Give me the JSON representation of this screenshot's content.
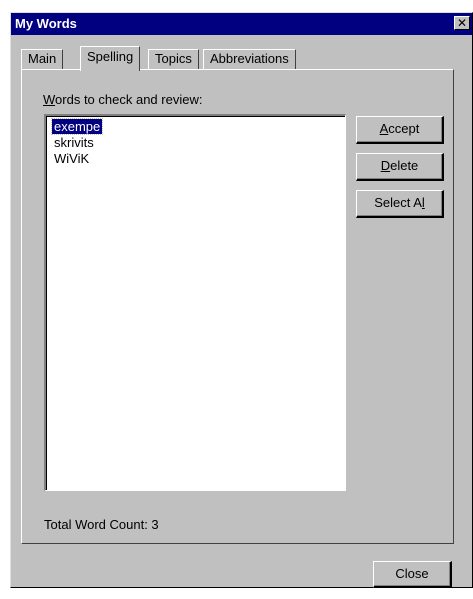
{
  "window": {
    "title": "My Words",
    "close_glyph": "✕"
  },
  "tabs": [
    {
      "label": "Main",
      "active": false
    },
    {
      "label": "Spelling",
      "active": true
    },
    {
      "label": "Topics",
      "active": false
    },
    {
      "label": "Abbreviations",
      "active": false
    }
  ],
  "spelling": {
    "list_label_mnemonic": "W",
    "list_label_rest": "ords to check and review:",
    "words": [
      {
        "text": "exempe",
        "selected": true
      },
      {
        "text": "skrivits",
        "selected": false
      },
      {
        "text": "WiViK",
        "selected": false
      }
    ],
    "buttons": {
      "accept_mnemonic": "A",
      "accept_rest": "ccept",
      "delete_mnemonic": "D",
      "delete_rest": "elete",
      "selectall_pre": "Select A",
      "selectall_mnemonic": "l",
      "selectall_post": "l"
    },
    "status": "Total Word Count: 3"
  },
  "footer": {
    "close_label": "Close"
  }
}
